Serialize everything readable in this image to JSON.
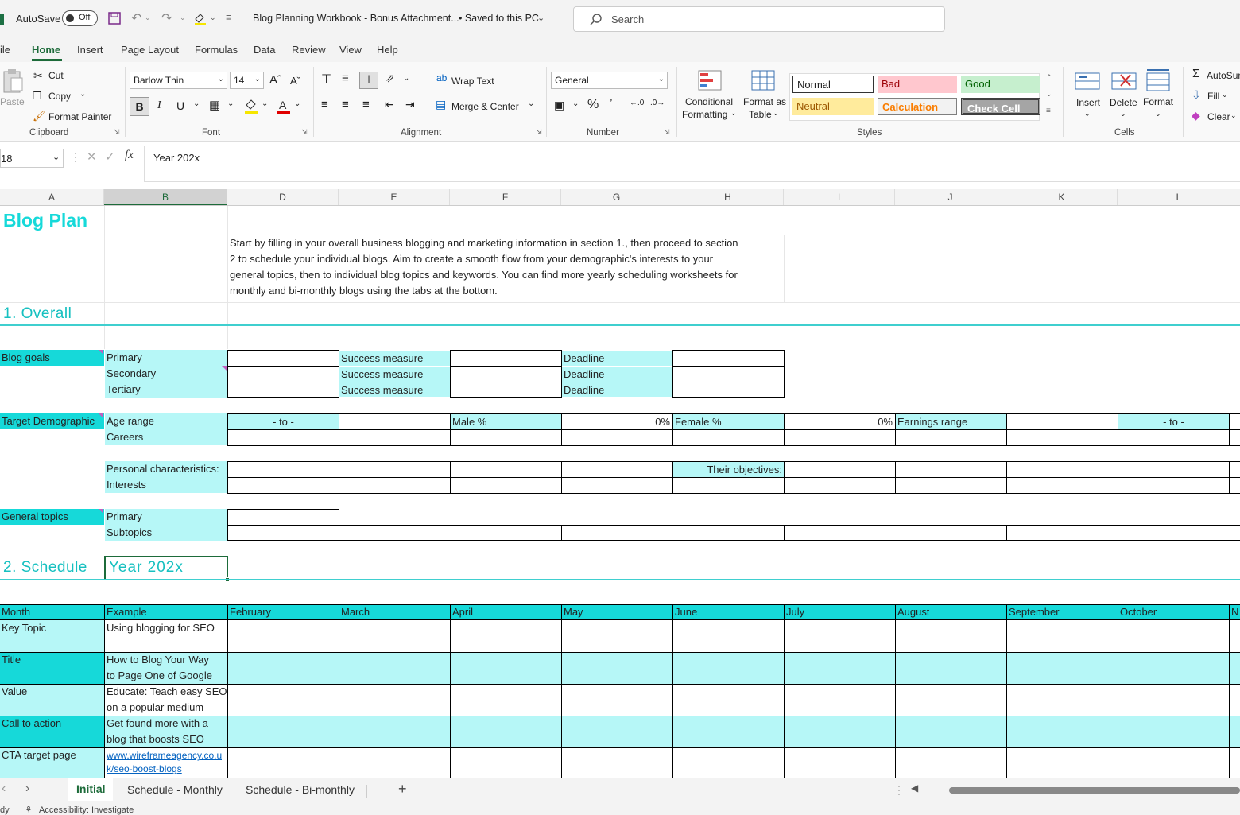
{
  "title_bar": {
    "autosave_label": "AutoSave",
    "autosave_state": "Off",
    "doc_title": "Blog Planning Workbook - Bonus Attachment...",
    "saved_status": "•  Saved to this PC",
    "search_placeholder": "Search"
  },
  "menu": [
    "ile",
    "Home",
    "Insert",
    "Page Layout",
    "Formulas",
    "Data",
    "Review",
    "View",
    "Help"
  ],
  "ribbon": {
    "clipboard": {
      "paste": "Paste",
      "cut": "Cut",
      "copy": "Copy",
      "format_painter": "Format Painter",
      "group": "Clipboard"
    },
    "font": {
      "name": "Barlow Thin",
      "size": "14",
      "group": "Font"
    },
    "alignment": {
      "wrap": "Wrap Text",
      "merge": "Merge & Center",
      "group": "Alignment"
    },
    "number": {
      "format": "General",
      "group": "Number"
    },
    "styles": {
      "cond_fmt_1": "Conditional",
      "cond_fmt_2": "Formatting",
      "fmt_table_1": "Format as",
      "fmt_table_2": "Table",
      "normal": "Normal",
      "bad": "Bad",
      "good": "Good",
      "neutral": "Neutral",
      "calculation": "Calculation",
      "check_cell": "Check Cell",
      "group": "Styles"
    },
    "cells": {
      "insert": "Insert",
      "delete": "Delete",
      "format": "Format",
      "group": "Cells"
    },
    "editing": {
      "autosum": "AutoSum",
      "fill": "Fill",
      "clear": "Clear"
    }
  },
  "formula_bar": {
    "name_box": "18",
    "content": "Year  202x"
  },
  "columns": [
    "A",
    "B",
    "D",
    "E",
    "F",
    "G",
    "H",
    "I",
    "J",
    "K",
    "L"
  ],
  "sheet": {
    "title": "Blog Plan",
    "intro": [
      "Start by filling in your overall business blogging and marketing information in section 1., then proceed to section",
      "2 to schedule your individual blogs. Aim to create a smooth flow from your demographic's interests to your",
      "general topics, then to individual blog topics and keywords. You can find more yearly scheduling worksheets for",
      "monthly and bi-monthly blogs using the tabs at the bottom."
    ],
    "section1": "1. Overall",
    "blog_goals": "Blog goals",
    "goal_rows": [
      "Primary",
      "Secondary",
      "Tertiary"
    ],
    "success_measure": "Success measure",
    "deadline": "Deadline",
    "target_demo": "Target Demographic",
    "age_range": "Age range",
    "to": "- to -",
    "male": "Male %",
    "male_val": "0%",
    "female": "Female %",
    "female_val": "0%",
    "earnings": "Earnings range",
    "careers": "Careers",
    "personal": "Personal characteristics:",
    "objectives": "Their objectives:",
    "interests": "Interests",
    "general_topics": "General topics",
    "primary": "Primary",
    "subtopics": "Subtopics",
    "section2": "2. Schedule",
    "year": "Year  202x",
    "sched_header": [
      "Month",
      "Example",
      "February",
      "March",
      "April",
      "May",
      "June",
      "July",
      "August",
      "September",
      "October",
      "N"
    ],
    "sched_rows": [
      {
        "label": "Key Topic",
        "example": [
          "Using blogging for SEO"
        ]
      },
      {
        "label": "Title",
        "example": [
          "How to Blog Your Way",
          "to Page One of Google"
        ]
      },
      {
        "label": "Value",
        "example": [
          "Educate: Teach easy SEO",
          "on a popular medium"
        ]
      },
      {
        "label": "Call to action",
        "example": [
          "Get found more with a",
          "blog that boosts SEO"
        ]
      },
      {
        "label": "CTA target page",
        "example": [
          "www.wireframeagency.co.u",
          "k/seo-boost-blogs"
        ]
      }
    ]
  },
  "sheet_tabs": [
    "Initial",
    "Schedule - Monthly",
    "Schedule - Bi-monthly"
  ],
  "status": {
    "left": "dy",
    "accessibility": "Accessibility: Investigate"
  }
}
